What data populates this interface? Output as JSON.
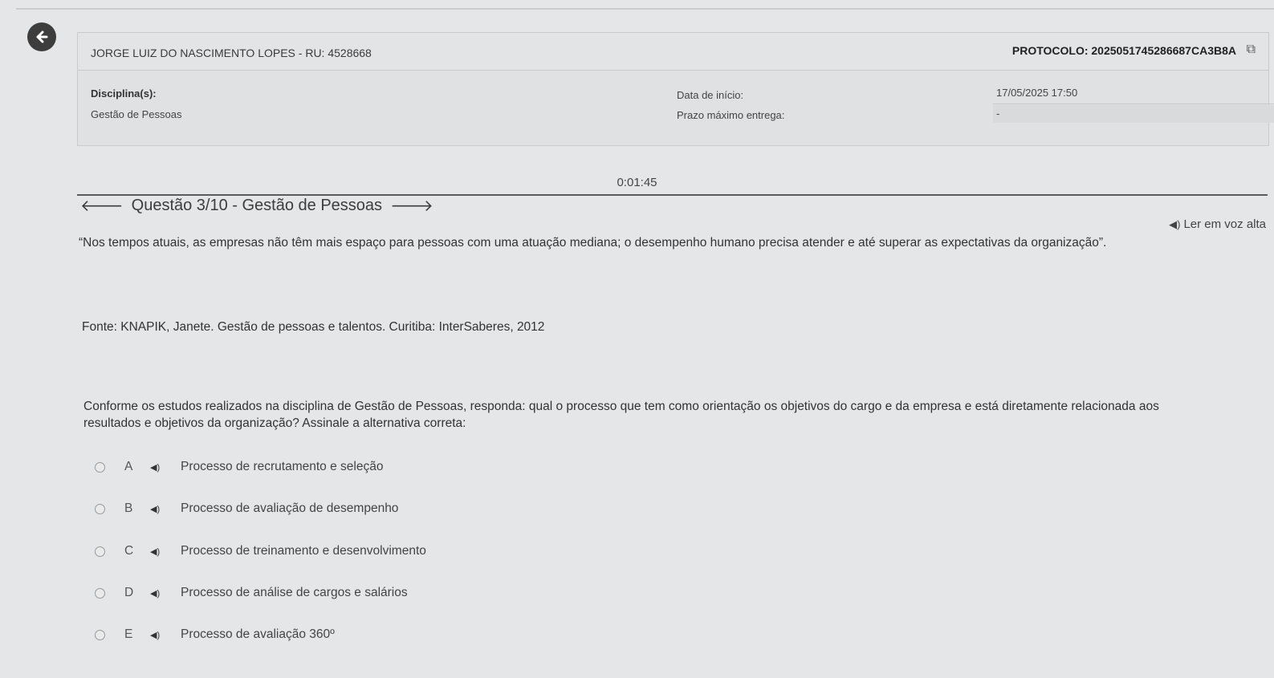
{
  "header": {
    "student": "JORGE LUIZ DO NASCIMENTO LOPES - RU: 4528668",
    "protocol": "PROTOCOLO: 2025051745286687CA3B8A",
    "disciplina_label": "Disciplina(s):",
    "disciplina_value": "Gestão de Pessoas",
    "data_inicio_label": "Data de início:",
    "data_inicio_value": "17/05/2025 17:50",
    "prazo_label": "Prazo máximo entrega:",
    "prazo_value": "-"
  },
  "timer": "0:01:45",
  "question_nav": {
    "title": "Questão 3/10 - Gestão de Pessoas"
  },
  "read_aloud": "Ler em voz alta",
  "quote": "“Nos tempos atuais, as empresas não têm mais espaço para pessoas com uma atuação mediana; o desempenho humano precisa atender e até superar as expectativas da organização”.",
  "fonte": "Fonte: KNAPIK, Janete. Gestão de pessoas e talentos. Curitiba: InterSaberes, 2012",
  "question": "Conforme os estudos realizados na disciplina de Gestão de Pessoas, responda: qual o processo que tem como orientação os objetivos do cargo e da empresa e está diretamente relacionada aos resultados e objetivos da organização? Assinale a alternativa correta:",
  "alternatives": [
    {
      "letter": "A",
      "text": "Processo de recrutamento e seleção"
    },
    {
      "letter": "B",
      "text": "Processo de avaliação de desempenho"
    },
    {
      "letter": "C",
      "text": "Processo de treinamento e desenvolvimento"
    },
    {
      "letter": "D",
      "text": "Processo de análise de cargos e salários"
    },
    {
      "letter": "E",
      "text": "Processo de avaliação 360º"
    }
  ],
  "icons": {
    "back": "arrow-left-circle-icon",
    "copy": "copy-icon",
    "prev": "arrow-left-icon",
    "next": "arrow-right-icon",
    "speaker": "speaker-icon"
  }
}
